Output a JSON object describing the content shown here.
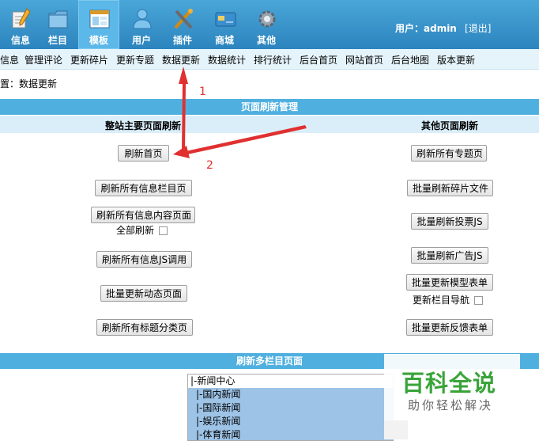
{
  "nav": {
    "items": [
      {
        "label": "信息",
        "icon": "pencil-icon"
      },
      {
        "label": "栏目",
        "icon": "folder-icon"
      },
      {
        "label": "模板",
        "icon": "window-icon",
        "active": true
      },
      {
        "label": "用户",
        "icon": "user-icon"
      },
      {
        "label": "插件",
        "icon": "tools-icon"
      },
      {
        "label": "商城",
        "icon": "card-icon"
      },
      {
        "label": "其他",
        "icon": "gear-icon"
      }
    ],
    "user_label": "用户：admin",
    "logout_label": "[退出]"
  },
  "submenu": [
    "信息",
    "管理评论",
    "更新碎片",
    "更新专题",
    "数据更新",
    "数据统计",
    "排行统计",
    "后台首页",
    "网站首页",
    "后台地图",
    "版本更新"
  ],
  "breadcrumb": "置：数据更新",
  "section1": {
    "title": "页面刷新管理",
    "left_header": "整站主要页面刷新",
    "right_header": "其他页面刷新",
    "left_buttons": [
      "刷新首页",
      "刷新所有信息栏目页",
      "刷新所有信息内容页面",
      "刷新所有信息JS调用",
      "批量更新动态页面",
      "刷新所有标题分类页"
    ],
    "left_check": "全部刷新",
    "right_buttons": [
      "刷新所有专题页",
      "批量刷新碎片文件",
      "批量刷新投票JS",
      "批量刷新广告JS",
      "批量更新模型表单",
      "批量更新反馈表单"
    ],
    "right_check": "更新栏目导航"
  },
  "annotations": {
    "a1": "1",
    "a2": "2",
    "arrow_color": "#e03030"
  },
  "section2": {
    "title": "刷新多栏目页面",
    "list": [
      {
        "text": "|-新闻中心",
        "selected": false
      },
      {
        "text": "|-国内新闻",
        "selected": true
      },
      {
        "text": "|-国际新闻",
        "selected": true
      },
      {
        "text": "|-娱乐新闻",
        "selected": true
      },
      {
        "text": "|-体育新闻",
        "selected": true
      }
    ]
  },
  "watermark": {
    "big": "百科全说",
    "small": "助你轻松解决"
  },
  "colors": {
    "topbar": "#3a97cf",
    "section_bar": "#4fb0e0",
    "subheader": "#d9eef9",
    "submenu": "#e5f4fb",
    "selection": "#9dc3e6",
    "watermark": "#3aa43a"
  }
}
